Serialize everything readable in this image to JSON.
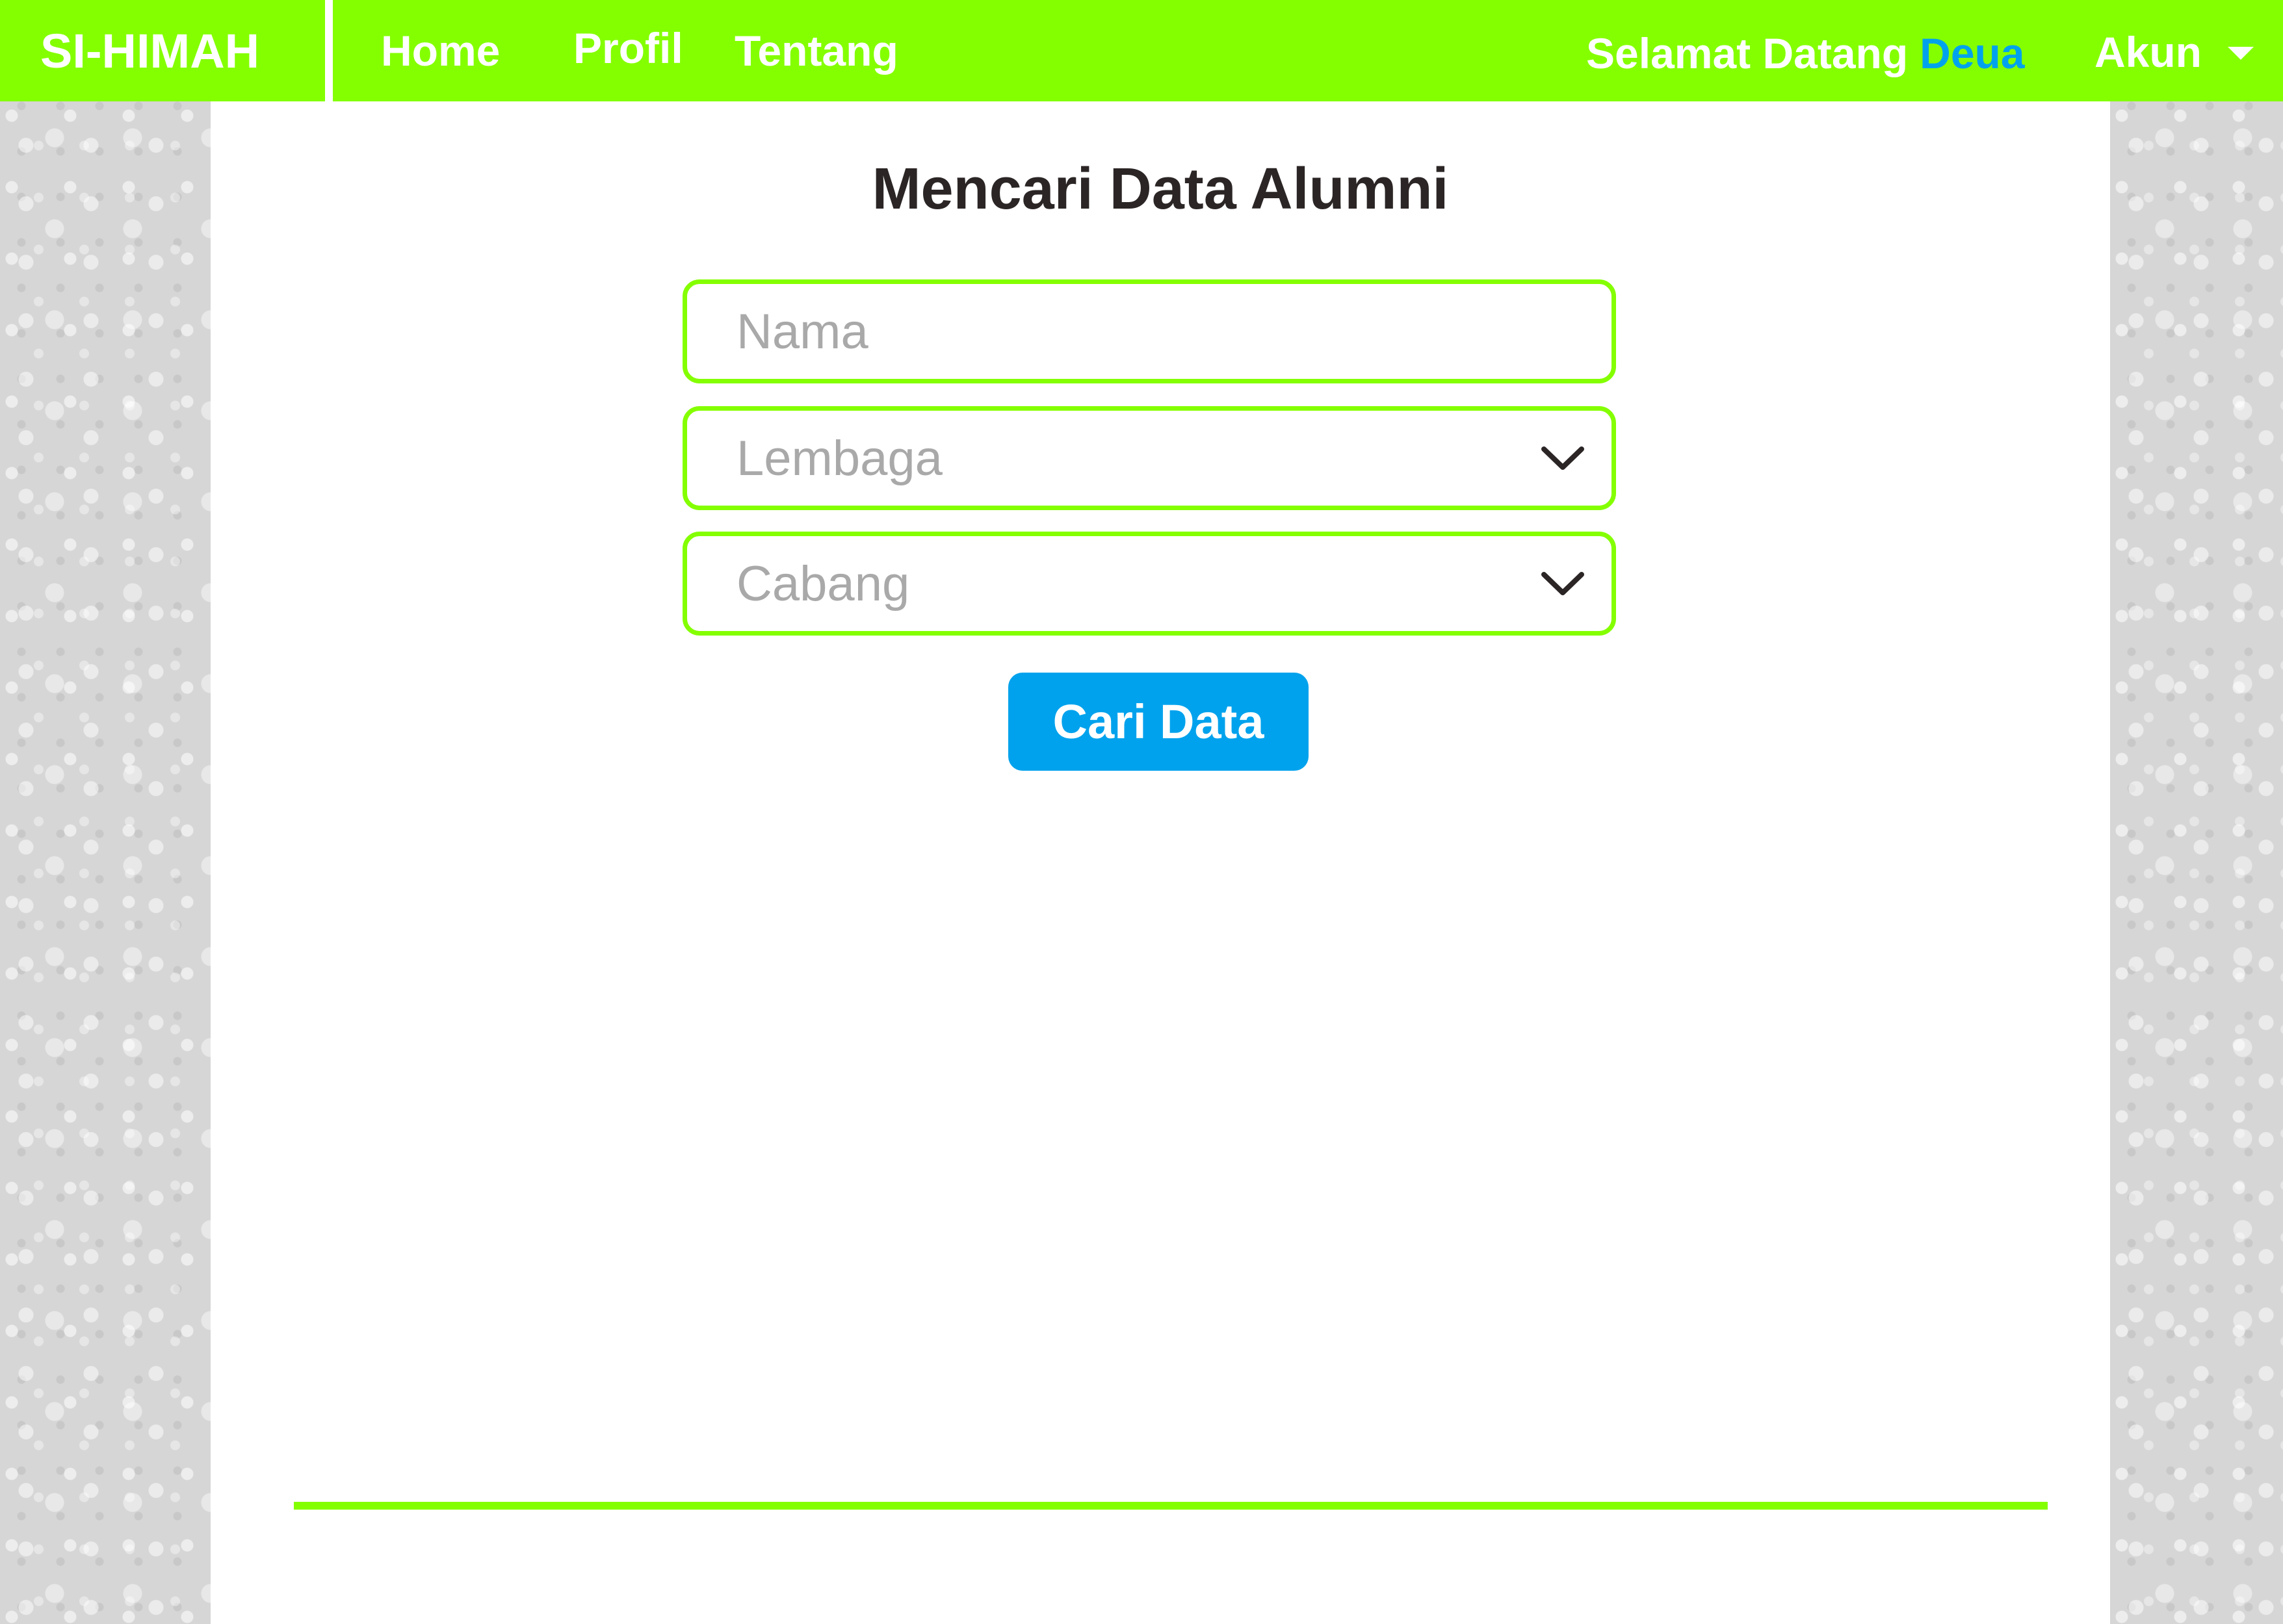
{
  "app": {
    "brand": "SI-HIMAH"
  },
  "nav": {
    "items": [
      {
        "label": "Home"
      },
      {
        "label": "Profil"
      },
      {
        "label": "Tentang"
      }
    ],
    "welcome_text": "Selamat Datang",
    "user_name": "Deua",
    "account_label": "Akun",
    "account_icon": "caret-down-icon"
  },
  "form": {
    "title": "Mencari Data Alumni",
    "nama_placeholder": "Nama",
    "lembaga_selected": "Lembaga",
    "cabang_selected": "Cabang",
    "submit_label": "Cari Data"
  },
  "colors": {
    "accent_green": "#84ff00",
    "accent_blue": "#00a2ed",
    "title_text": "#2b2525",
    "placeholder_text": "#a9a9a9"
  }
}
